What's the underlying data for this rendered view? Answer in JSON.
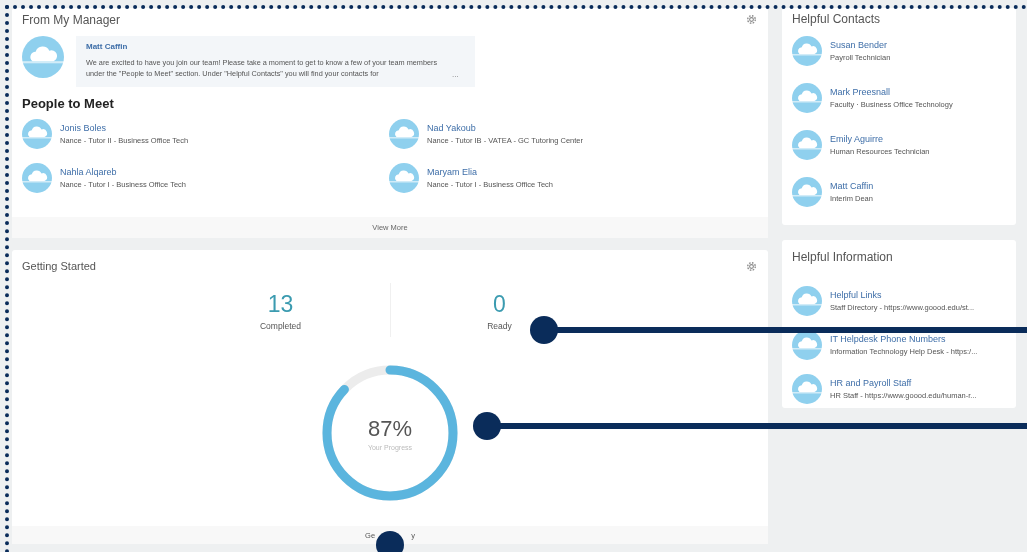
{
  "manager": {
    "title": "From My Manager",
    "sender": "Matt Caffin",
    "message": "We are excited to have you join our team! Please take a moment to get to know a few of your team members under the \"People to Meet\" section. Under \"Helpful Contacts\" you will find your contacts for",
    "more": "...",
    "people_title": "People to Meet",
    "people": [
      {
        "name": "Jonis Boles",
        "role": "Nance - Tutor II - Business Office Tech"
      },
      {
        "name": "Nad Yakoub",
        "role": "Nance - Tutor IB - VATEA - GC Tutoring Center"
      },
      {
        "name": "Nahla Alqareb",
        "role": "Nance - Tutor I - Business Office Tech"
      },
      {
        "name": "Maryam Elia",
        "role": "Nance - Tutor I - Business Office Tech"
      }
    ],
    "footer": "View More"
  },
  "getting_started": {
    "title": "Getting Started",
    "stats": [
      {
        "value": "13",
        "label": "Completed"
      },
      {
        "value": "0",
        "label": "Ready"
      }
    ],
    "progress": {
      "reading": "87%",
      "label": "Your Progress"
    },
    "footer_parts": [
      "Ge",
      "y"
    ]
  },
  "contacts": {
    "title": "Helpful Contacts",
    "items": [
      {
        "name": "Susan Bender",
        "role": "Payroll Technician"
      },
      {
        "name": "Mark Preesnall",
        "role": "Faculty · Business Office Technology"
      },
      {
        "name": "Emily Aguirre",
        "role": "Human Resources Technician"
      },
      {
        "name": "Matt Caffin",
        "role": "Interim Dean"
      }
    ]
  },
  "information": {
    "title": "Helpful Information",
    "items": [
      {
        "name": "Helpful Links",
        "detail": "Staff Directory - https://www.goood.edu/st..."
      },
      {
        "name": "IT Helpdesk Phone Numbers",
        "detail": "Information Technology Help Desk - https:/..."
      },
      {
        "name": "HR and Payroll Staff",
        "detail": "HR Staff - https://www.goood.edu/human-r..."
      }
    ]
  }
}
